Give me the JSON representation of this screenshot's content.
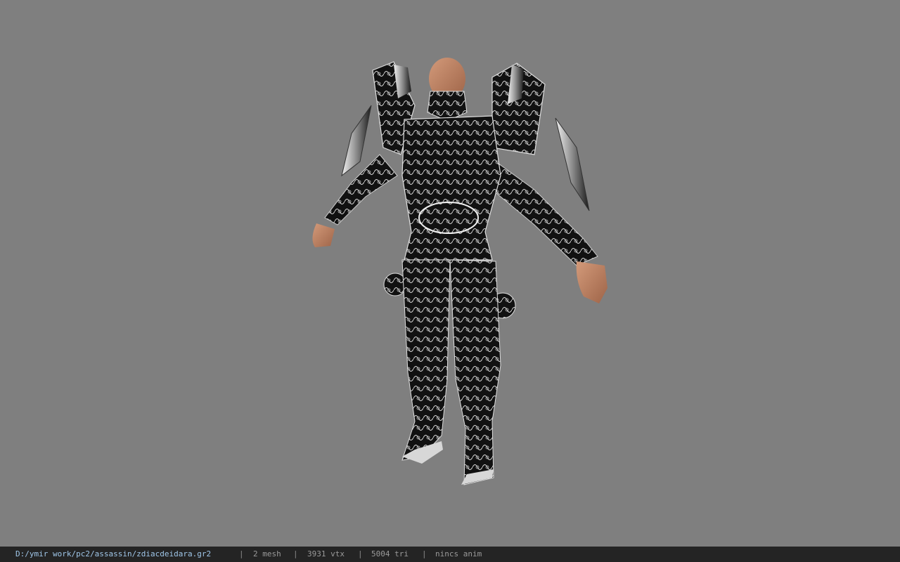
{
  "viewer": {
    "background_color": "#7f7f7f",
    "model_name": "zdiacdeidara"
  },
  "status": {
    "file_path": "D:/ymir work/pc2/assassin/zdiacdeidara.gr2",
    "separator": "|",
    "mesh": "2 mesh",
    "vertices": "3931 vtx",
    "triangles": "5004 tri",
    "animation": "nincs anim"
  }
}
